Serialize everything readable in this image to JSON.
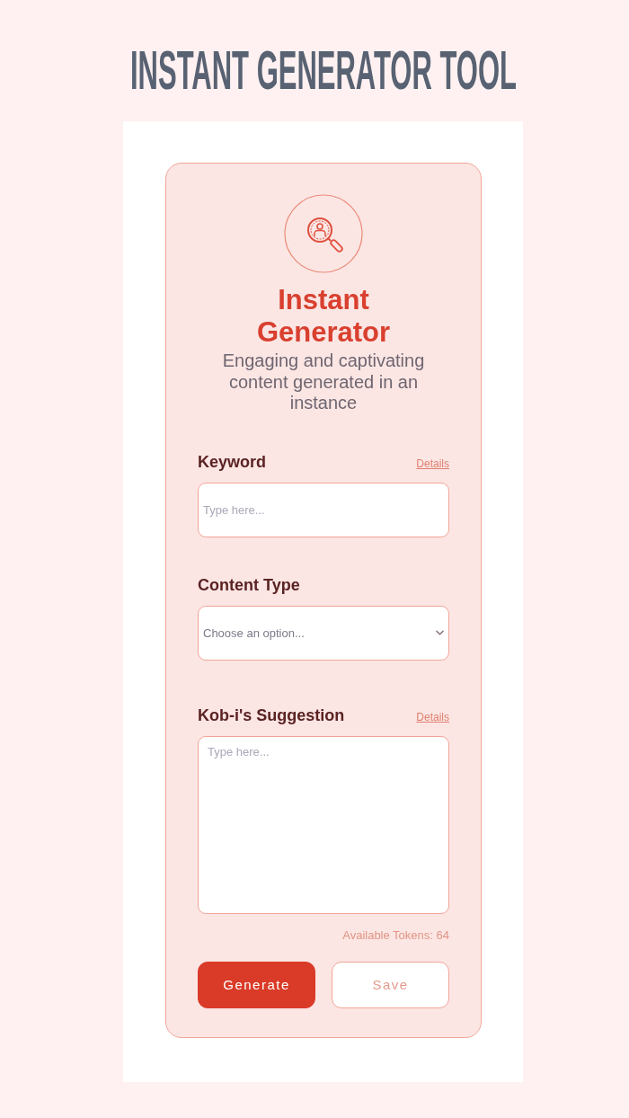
{
  "header": {
    "title": "INSTANT GENERATOR TOOL"
  },
  "card": {
    "title": "Instant Generator",
    "subtitle": "Engaging and captivating content generated in an instance"
  },
  "fields": [
    {
      "kind": "text",
      "label": "Keyword",
      "link": "Details",
      "placeholder": "Type here..."
    },
    {
      "kind": "select",
      "label": "Content Type",
      "placeholder": "Choose an option..."
    },
    {
      "kind": "textarea",
      "label": "Kob-i's Suggestion",
      "link": "Details",
      "placeholder": "Type here..."
    }
  ],
  "tokens": "Available Tokens: 64",
  "buttons": [
    {
      "kind": "primary",
      "label": "Generate"
    },
    {
      "kind": "secondary",
      "label": "Save"
    }
  ]
}
